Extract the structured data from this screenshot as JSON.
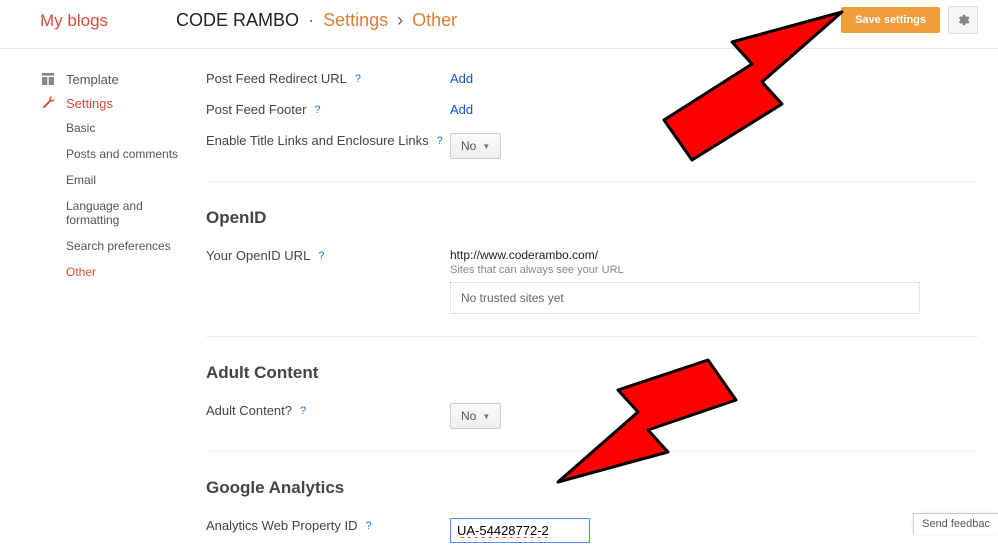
{
  "header": {
    "my_blogs": "My blogs",
    "blog_title": "CODE RAMBO",
    "crumb_settings": "Settings",
    "crumb_other": "Other",
    "save_label": "Save settings"
  },
  "sidebar": {
    "template": "Template",
    "settings": "Settings",
    "sub": {
      "basic": "Basic",
      "posts": "Posts and comments",
      "email": "Email",
      "lang": "Language and formatting",
      "search": "Search preferences",
      "other": "Other"
    }
  },
  "feed": {
    "redirect_label": "Post Feed Redirect URL",
    "redirect_action": "Add",
    "footer_label": "Post Feed Footer",
    "footer_action": "Add",
    "enclosure_label": "Enable Title Links and Enclosure Links",
    "enclosure_value": "No"
  },
  "openid": {
    "title": "OpenID",
    "label": "Your OpenID URL",
    "url": "http://www.coderambo.com/",
    "subtext": "Sites that can always see your URL",
    "trusted": "No trusted sites yet"
  },
  "adult": {
    "title": "Adult Content",
    "label": "Adult Content?",
    "value": "No"
  },
  "analytics": {
    "title": "Google Analytics",
    "label": "Analytics Web Property ID",
    "value": "UA-54428772-2"
  },
  "feedback": "Send feedbac"
}
